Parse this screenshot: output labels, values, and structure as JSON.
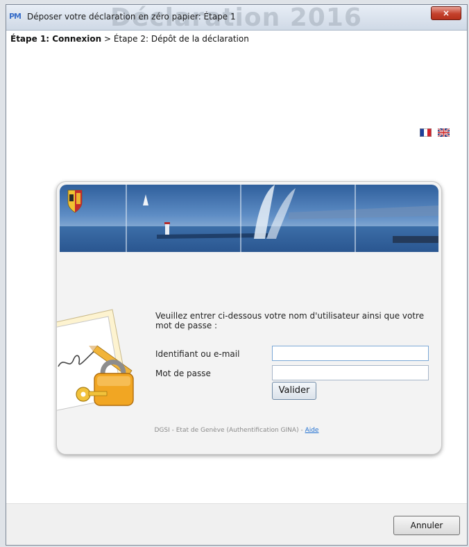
{
  "window": {
    "title": "Déposer votre déclaration en zéro papier: Étape 1",
    "app_icon_text": "PM",
    "close_glyph": "×",
    "background_watermark": "Déclaration 2016"
  },
  "breadcrumb": {
    "step1": "Étape 1: Connexion",
    "separator": " > ",
    "step2": "Étape 2: Dépôt de la déclaration"
  },
  "languages": [
    {
      "code": "fr",
      "icon": "flag-france-icon"
    },
    {
      "code": "en",
      "icon": "flag-uk-icon"
    }
  ],
  "login": {
    "prompt": "Veuillez entrer ci-dessous votre nom d'utilisateur ainsi que votre mot de passe :",
    "username_label": "Identifiant ou e-mail",
    "username_value": "",
    "password_label": "Mot de passe",
    "password_value": "",
    "submit_label": "Valider"
  },
  "footer": {
    "text": "DGSI - Etat de Genève (Authentification GINA) - ",
    "help_link": "Aide"
  },
  "actions": {
    "cancel_label": "Annuler"
  },
  "colors": {
    "link": "#1f6fd0",
    "close_button": "#c4412c",
    "banner_sky": "#3b6ea8"
  }
}
